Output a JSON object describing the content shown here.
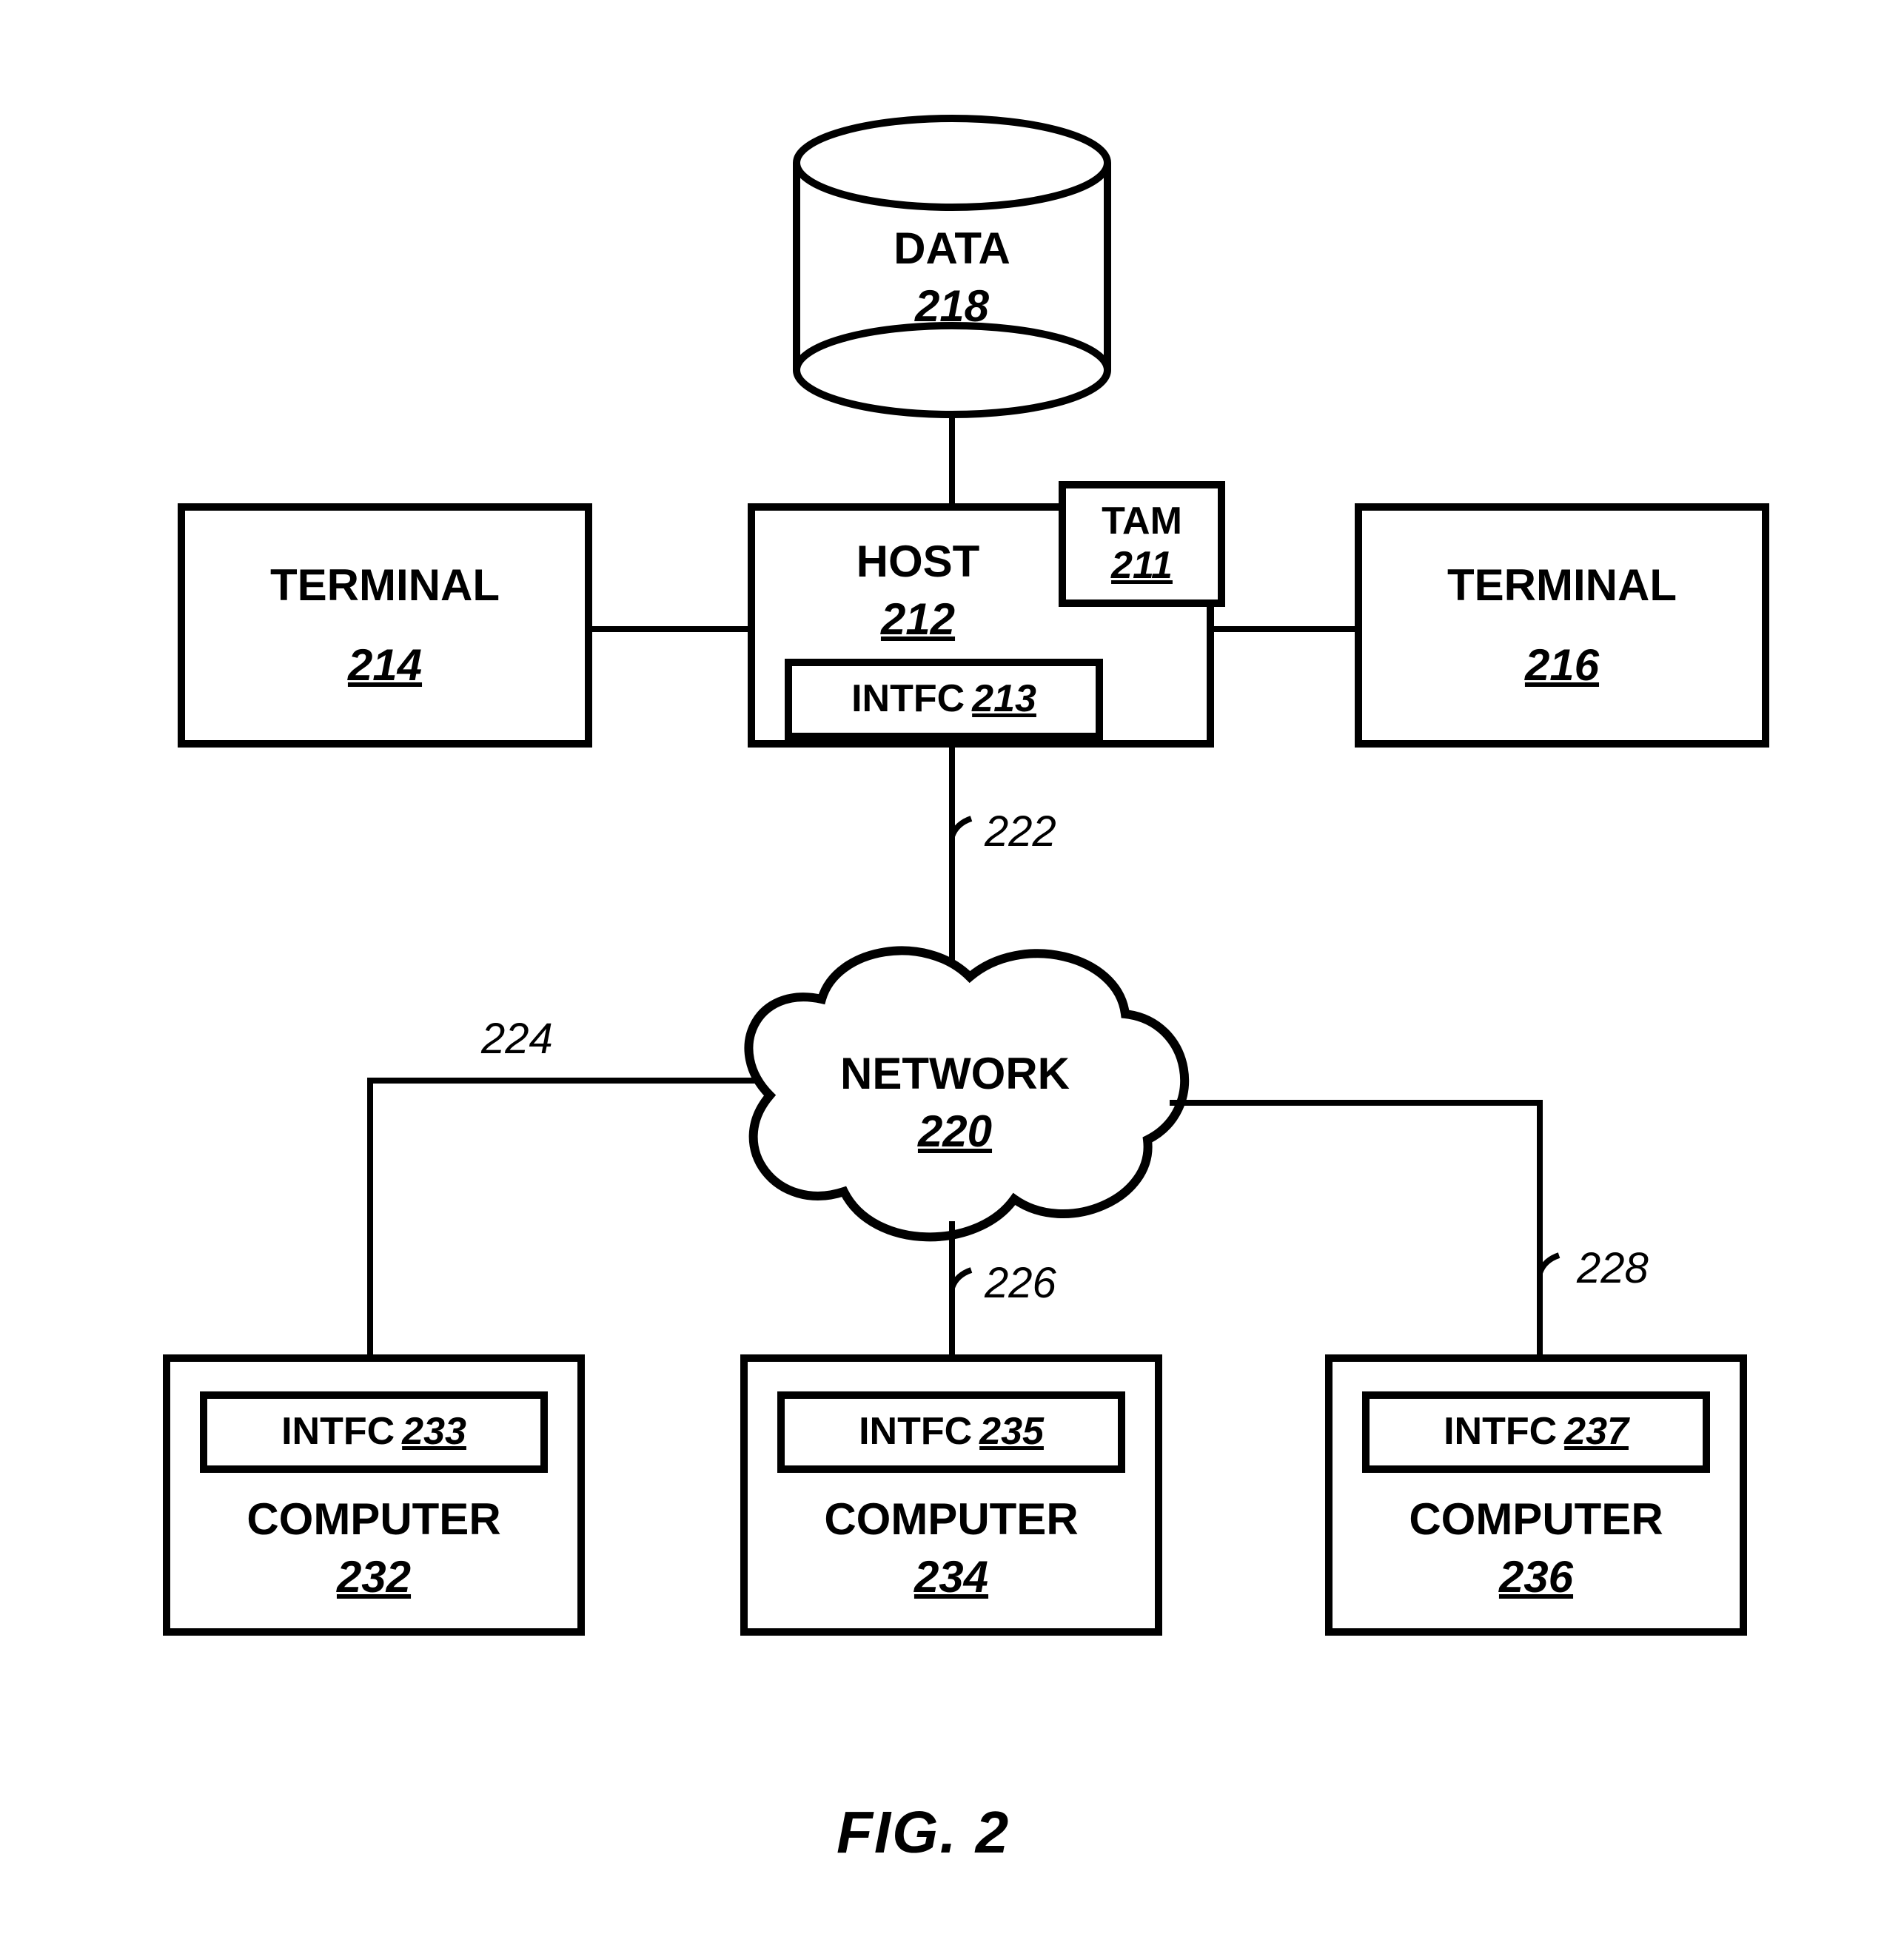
{
  "nodes": {
    "data": {
      "label": "DATA",
      "ref": "218"
    },
    "host": {
      "label": "HOST",
      "ref": "212"
    },
    "tam": {
      "label": "TAM",
      "ref": "211"
    },
    "intfc_host": {
      "label": "INTFC",
      "ref": "213"
    },
    "term_l": {
      "label": "TERMINAL",
      "ref": "214"
    },
    "term_r": {
      "label": "TERMINAL",
      "ref": "216"
    },
    "network": {
      "label": "NETWORK",
      "ref": "220"
    },
    "comp_l": {
      "label": "COMPUTER",
      "ref": "232"
    },
    "comp_m": {
      "label": "COMPUTER",
      "ref": "234"
    },
    "comp_r": {
      "label": "COMPUTER",
      "ref": "236"
    },
    "intfc_l": {
      "label": "INTFC",
      "ref": "233"
    },
    "intfc_m": {
      "label": "INTFC",
      "ref": "235"
    },
    "intfc_r": {
      "label": "INTFC",
      "ref": "237"
    }
  },
  "links": {
    "host_net": "222",
    "net_l": "224",
    "net_m": "226",
    "net_r": "228"
  },
  "caption": "FIG. 2"
}
